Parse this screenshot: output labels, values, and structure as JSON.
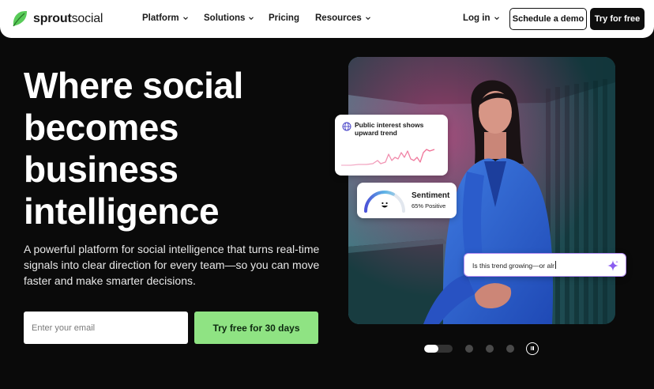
{
  "brand": {
    "name_bold": "sprout",
    "name_light": "social",
    "accent": "#59cb59"
  },
  "nav": {
    "items": [
      {
        "label": "Platform",
        "has_dropdown": true
      },
      {
        "label": "Solutions",
        "has_dropdown": true
      },
      {
        "label": "Pricing",
        "has_dropdown": false
      },
      {
        "label": "Resources",
        "has_dropdown": true
      },
      {
        "label": "Log in",
        "has_dropdown": true
      }
    ],
    "demo_label": "Schedule a demo",
    "try_label": "Try for free"
  },
  "hero": {
    "headline": "Where social becomes business intelligence",
    "subtext": "A powerful platform for social intelligence that turns real-time signals into clear direction for every team—so you can move faster and make smarter decisions.",
    "email_placeholder": "Enter your email",
    "cta_label": "Try free for 30 days",
    "cta_color": "#8fe383"
  },
  "cards": {
    "trend": {
      "title": "Public interest shows upward trend",
      "icon": "globe-icon"
    },
    "sentiment": {
      "title": "Sentiment",
      "value": "65% Positive",
      "level": 0.65
    },
    "query": {
      "text": "Is this trend growing—or alr",
      "icon": "sparkle-icon"
    }
  },
  "carousel": {
    "slide_count": 4,
    "active_index": 0,
    "active_progress": 0.5,
    "pause_icon": "pause-icon"
  }
}
